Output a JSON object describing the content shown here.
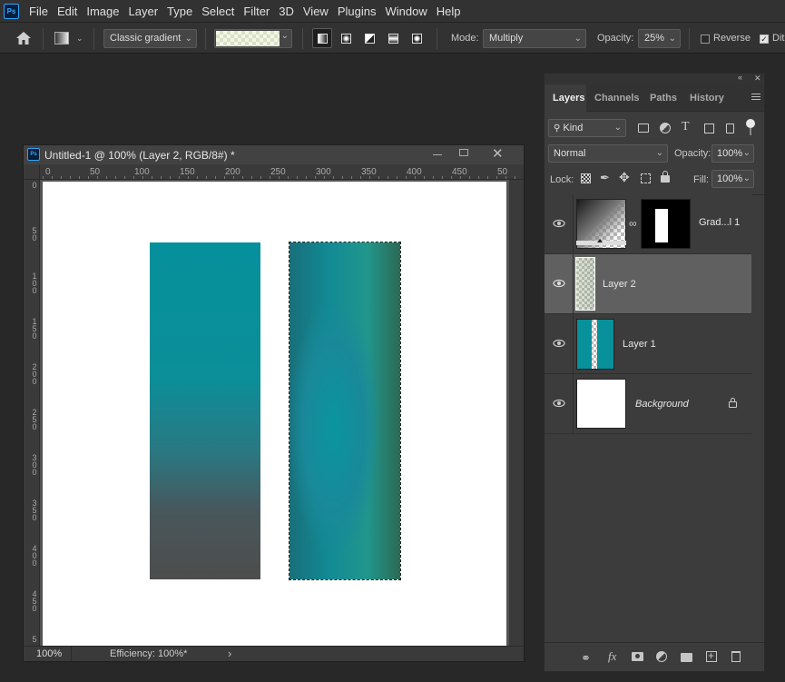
{
  "app": {
    "logo": "Ps"
  },
  "menu": [
    "File",
    "Edit",
    "Image",
    "Layer",
    "Type",
    "Select",
    "Filter",
    "3D",
    "View",
    "Plugins",
    "Window",
    "Help"
  ],
  "options": {
    "gradient_type": "Classic gradient",
    "mode_label": "Mode:",
    "mode_value": "Multiply",
    "opacity_label": "Opacity:",
    "opacity_value": "25%",
    "reverse_label": "Reverse",
    "dither_label": "Dit"
  },
  "document": {
    "title": "Untitled-1 @ 100% (Layer 2, RGB/8#) *",
    "ruler_top": [
      "0",
      "50",
      "100",
      "150",
      "200",
      "250",
      "300",
      "350",
      "400",
      "450",
      "50"
    ],
    "ruler_left": [
      "0",
      "5\n0",
      "1\n0\n0",
      "1\n5\n0",
      "2\n0\n0",
      "2\n5\n0",
      "3\n0\n0",
      "3\n5\n0",
      "4\n0\n0",
      "4\n5\n0",
      "5"
    ],
    "zoom": "100%",
    "efficiency": "Efficiency: 100%*"
  },
  "layers_panel": {
    "tabs": [
      "Layers",
      "Channels",
      "Paths",
      "History"
    ],
    "active_tab": "Layers",
    "filter_kind": "Kind",
    "blend_mode": "Normal",
    "opacity_label": "Opacity:",
    "opacity_value": "100%",
    "lock_label": "Lock:",
    "fill_label": "Fill:",
    "fill_value": "100%",
    "layers": [
      {
        "name": "Grad...l 1",
        "type": "gradient-fill"
      },
      {
        "name": "Layer 2",
        "type": "pixel",
        "selected": true
      },
      {
        "name": "Layer 1",
        "type": "pixel"
      },
      {
        "name": "Background",
        "type": "background",
        "locked": true
      }
    ]
  },
  "colors": {
    "teal": "#0a8f9c",
    "accent": "#31a8ff",
    "panel_bg": "#3c3c3c",
    "selected_row": "#606060"
  }
}
